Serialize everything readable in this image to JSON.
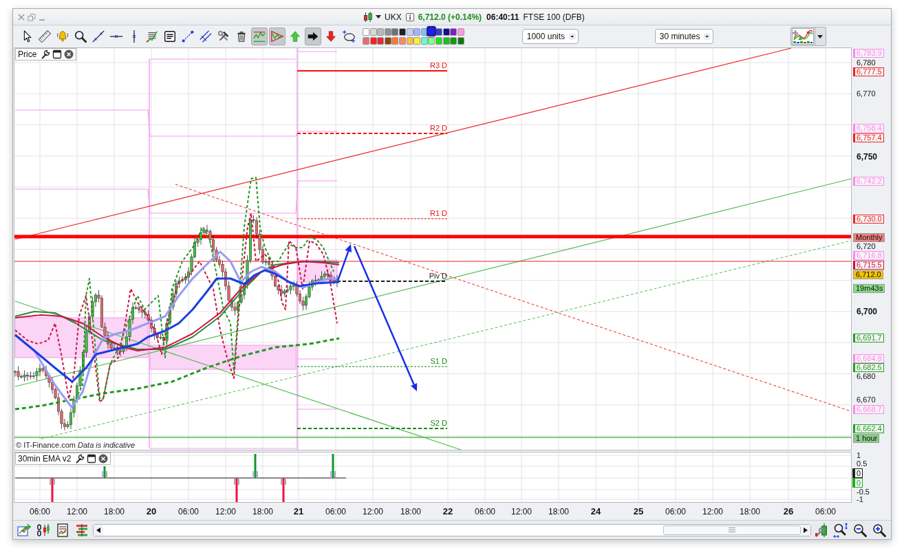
{
  "title_bar": {
    "symbol": "UKX",
    "quote": "6,712.0 (+0.14%)",
    "time": "06:40:11",
    "market": "FTSE 100 (DFB)"
  },
  "toolbar": {
    "tools": [
      {
        "selected": false
      },
      {
        "selected": false
      },
      {
        "selected": false
      },
      {
        "selected": false
      },
      {
        "selected": false
      },
      {
        "selected": false
      },
      {
        "selected": false
      },
      {
        "selected": false
      },
      {
        "selected": false
      },
      {
        "selected": false
      },
      {
        "selected": false
      },
      {
        "selected": false
      },
      {
        "selected": false
      },
      {
        "selected": true
      },
      {
        "selected": true
      },
      {
        "selected": false
      },
      {
        "selected": true
      },
      {
        "selected": false
      },
      {
        "selected": false
      }
    ],
    "palette": [
      {
        "color": "#ffffff",
        "selected": false
      },
      {
        "color": "#d8d8d8",
        "selected": false
      },
      {
        "color": "#b8b8b8",
        "selected": false
      },
      {
        "color": "#909090",
        "selected": false
      },
      {
        "color": "#707070",
        "selected": false
      },
      {
        "color": "#202020",
        "selected": false
      },
      {
        "color": "#c8d0ff",
        "selected": false
      },
      {
        "color": "#a0b4ff",
        "selected": false
      },
      {
        "color": "#80c0ff",
        "selected": false
      },
      {
        "color": "#2020ee",
        "selected": true
      },
      {
        "color": "#3040d0",
        "selected": false
      },
      {
        "color": "#101090",
        "selected": false
      },
      {
        "color": "#8020c0",
        "selected": false
      },
      {
        "color": "#ff99dd",
        "selected": false
      },
      {
        "color": "#e07070",
        "selected": false
      },
      {
        "color": "#ff2020",
        "selected": false
      },
      {
        "color": "#e03030",
        "selected": false
      },
      {
        "color": "#8b4513",
        "selected": false
      },
      {
        "color": "#ff7733",
        "selected": false
      },
      {
        "color": "#ff8866",
        "selected": false
      },
      {
        "color": "#ffc040",
        "selected": false
      },
      {
        "color": "#ffee33",
        "selected": false
      },
      {
        "color": "#66ffcc",
        "selected": false
      },
      {
        "color": "#88ff88",
        "selected": false
      },
      {
        "color": "#22dd22",
        "selected": false
      },
      {
        "color": "#22bb22",
        "selected": false
      },
      {
        "color": "#119911",
        "selected": false
      },
      {
        "color": "#117711",
        "selected": false
      }
    ],
    "quantity": "1000 units",
    "interval": "30 minutes"
  },
  "price_pane": {
    "title": "Price",
    "pivot_labels": [
      {
        "label": "R3 D",
        "color": "#ee1111"
      },
      {
        "label": "R2 D",
        "color": "#ee1111"
      },
      {
        "label": "R1 D",
        "color": "#ee1111"
      },
      {
        "label": "Piv D",
        "color": "#222222"
      },
      {
        "label": "S1 D",
        "color": "#118811"
      },
      {
        "label": "S2 D",
        "color": "#118811"
      }
    ],
    "attribution": "© IT-Finance.com *Data is indicative*",
    "axis_ticks": [
      {
        "label": "6,780",
        "kind": "minor"
      },
      {
        "label": "6,770",
        "kind": "minor"
      },
      {
        "label": "6,750",
        "kind": "major"
      },
      {
        "label": "6,720",
        "kind": "minor"
      },
      {
        "label": "6,700",
        "kind": "major"
      },
      {
        "label": "6,680",
        "kind": "minor"
      },
      {
        "label": "6,670",
        "kind": "minor"
      }
    ],
    "price_tags": [
      {
        "label": "6,783.9",
        "kind": "outlined",
        "color": "#ff88ee"
      },
      {
        "label": "6,777.5",
        "kind": "outlined",
        "color": "#ee2222"
      },
      {
        "label": "6,758.4",
        "kind": "outlined",
        "color": "#ff88ee"
      },
      {
        "label": "6,757.4",
        "kind": "outlined",
        "color": "#ee2222"
      },
      {
        "label": "6,742.2",
        "kind": "outlined",
        "color": "#ff88ee"
      },
      {
        "label": "6,730.0",
        "kind": "outlined",
        "color": "#ee2222"
      },
      {
        "label": "Monthly",
        "kind": "filled",
        "color": "#f08080"
      },
      {
        "label": "6,716.8",
        "kind": "outlined",
        "color": "#ff88ee"
      },
      {
        "label": "6,715.5",
        "kind": "outlined",
        "color": "#cc1144"
      },
      {
        "label": "6,712.0",
        "kind": "filled",
        "color": "#f5c400"
      },
      {
        "label": "19m43s",
        "kind": "filled",
        "color": "#88dd88"
      },
      {
        "label": "6,691.7",
        "kind": "outlined",
        "color": "#22a022"
      },
      {
        "label": "6,684.8",
        "kind": "outlined",
        "color": "#ff88ee"
      },
      {
        "label": "6,682.5",
        "kind": "outlined",
        "color": "#22a022"
      },
      {
        "label": "6,668.7",
        "kind": "outlined",
        "color": "#ff88ee"
      },
      {
        "label": "6,662.4",
        "kind": "outlined",
        "color": "#22a022"
      },
      {
        "label": "1 hour",
        "kind": "filled",
        "color": "#88cc88"
      }
    ]
  },
  "indicator_pane": {
    "title": "30min EMA v2",
    "axis_ticks": [
      {
        "label": "1"
      },
      {
        "label": "0.5"
      },
      {
        "label": "-0.5"
      },
      {
        "label": "-1"
      }
    ],
    "value_tags": [
      {
        "label": "0",
        "color": "#222222"
      },
      {
        "label": "0",
        "color": "#22aa22"
      }
    ]
  },
  "time_axis": [
    {
      "label": "06:00",
      "kind": "time"
    },
    {
      "label": "12:00",
      "kind": "time"
    },
    {
      "label": "18:00",
      "kind": "time"
    },
    {
      "label": "20",
      "kind": "day"
    },
    {
      "label": "06:00",
      "kind": "time"
    },
    {
      "label": "12:00",
      "kind": "time"
    },
    {
      "label": "18:00",
      "kind": "time"
    },
    {
      "label": "21",
      "kind": "day"
    },
    {
      "label": "06:00",
      "kind": "time"
    },
    {
      "label": "12:00",
      "kind": "time"
    },
    {
      "label": "18:00",
      "kind": "time"
    },
    {
      "label": "22",
      "kind": "day"
    },
    {
      "label": "06:00",
      "kind": "time"
    },
    {
      "label": "12:00",
      "kind": "time"
    },
    {
      "label": "18:00",
      "kind": "time"
    },
    {
      "label": "24",
      "kind": "day"
    },
    {
      "label": "25",
      "kind": "day"
    },
    {
      "label": "06:00",
      "kind": "time"
    },
    {
      "label": "12:00",
      "kind": "time"
    },
    {
      "label": "18:00",
      "kind": "time"
    },
    {
      "label": "26",
      "kind": "day"
    },
    {
      "label": "06:00",
      "kind": "time"
    }
  ]
}
